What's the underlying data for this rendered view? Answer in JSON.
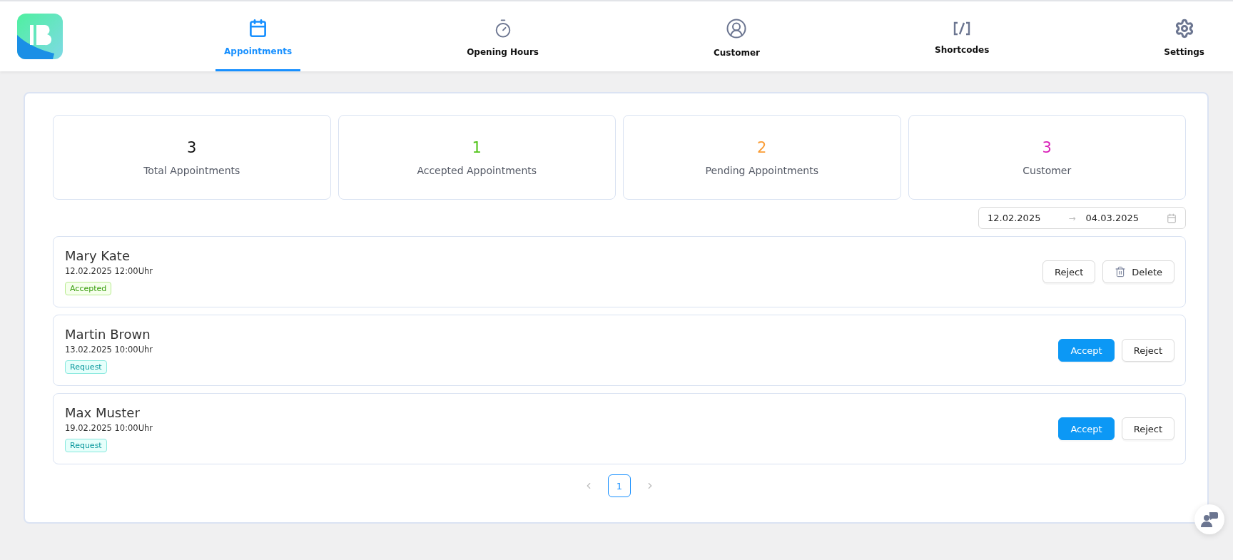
{
  "nav": {
    "tabs": [
      {
        "label": "Appointments",
        "kind": "calendar",
        "selected": true
      },
      {
        "label": "Opening Hours",
        "kind": "stopwatch",
        "selected": false
      },
      {
        "label": "Customer",
        "kind": "users",
        "selected": false
      },
      {
        "label": "Shortcodes",
        "kind": "code",
        "selected": false
      },
      {
        "label": "Settings",
        "kind": "gear",
        "selected": false
      }
    ]
  },
  "stats": [
    {
      "value": "3",
      "label": "Total Appointments",
      "color": "#111111"
    },
    {
      "value": "1",
      "label": "Accepted Appointments",
      "color": "#52c41a"
    },
    {
      "value": "2",
      "label": "Pending Appointments",
      "color": "#fa9c35"
    },
    {
      "value": "3",
      "label": "Customer",
      "color": "#d91fb8"
    }
  ],
  "date_range": {
    "start": "12.02.2025",
    "separator": "→",
    "end": "04.03.2025"
  },
  "appointments": [
    {
      "name": "Mary Kate",
      "datetime": "12.02.2025 12:00Uhr",
      "status": {
        "kind": "accepted",
        "label": "Accepted"
      },
      "actions": [
        {
          "kind": "reject",
          "label": "Reject"
        },
        {
          "kind": "delete",
          "label": "Delete"
        }
      ]
    },
    {
      "name": "Martin Brown",
      "datetime": "13.02.2025 10:00Uhr",
      "status": {
        "kind": "request",
        "label": "Request"
      },
      "actions": [
        {
          "kind": "accept",
          "label": "Accept"
        },
        {
          "kind": "reject",
          "label": "Reject"
        }
      ]
    },
    {
      "name": "Max Muster",
      "datetime": "19.02.2025 10:00Uhr",
      "status": {
        "kind": "request",
        "label": "Request"
      },
      "actions": [
        {
          "kind": "accept",
          "label": "Accept"
        },
        {
          "kind": "reject",
          "label": "Reject"
        }
      ]
    }
  ],
  "pagination": {
    "pages": [
      {
        "label": "1",
        "selected": true
      }
    ]
  }
}
